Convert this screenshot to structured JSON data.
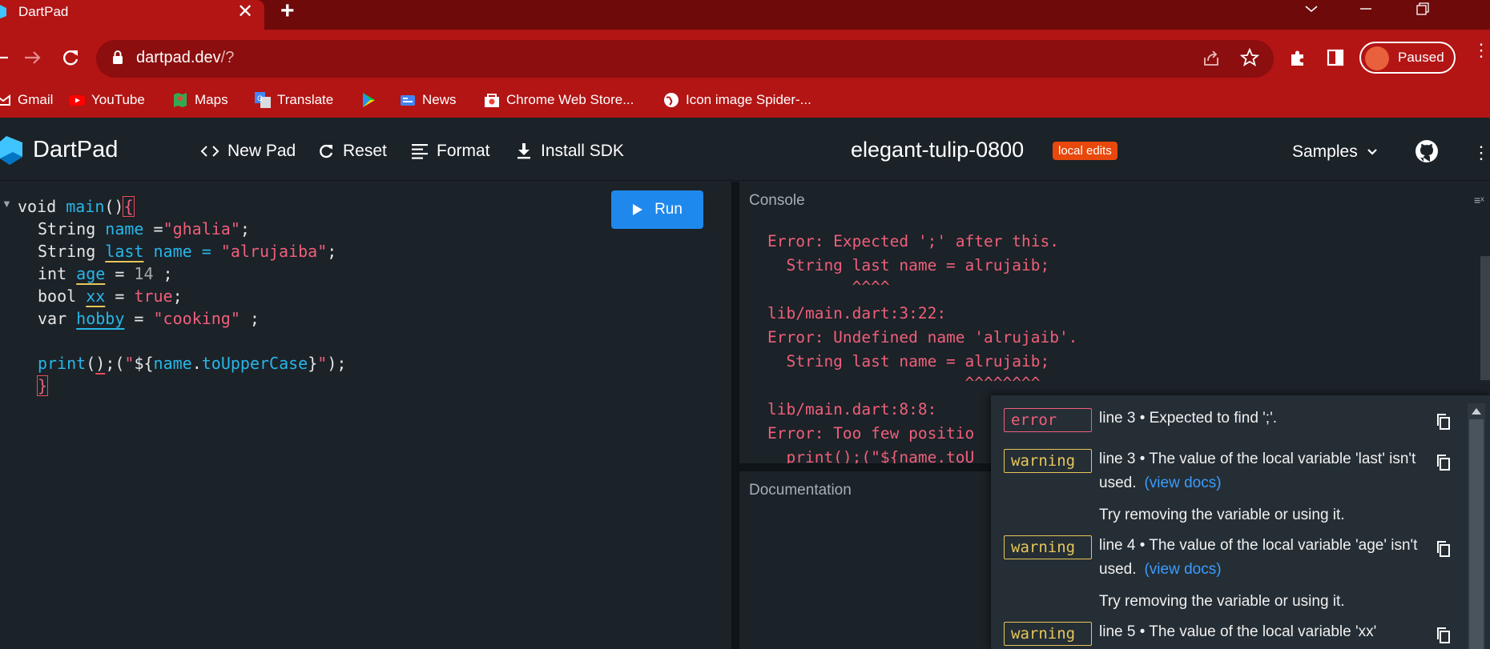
{
  "browser": {
    "tab": {
      "title": "DartPad",
      "close": "✕"
    },
    "new_tab": "+",
    "url": {
      "host": "dartpad.dev",
      "path": "/?"
    },
    "profile": {
      "status": "Paused"
    },
    "bookmarks": [
      {
        "label": "Gmail",
        "icon": "gmail-icon"
      },
      {
        "label": "YouTube",
        "icon": "youtube-icon"
      },
      {
        "label": "Maps",
        "icon": "maps-icon"
      },
      {
        "label": "Translate",
        "icon": "translate-icon"
      },
      {
        "label": "",
        "icon": "play-store-icon"
      },
      {
        "label": "News",
        "icon": "news-icon"
      },
      {
        "label": "Chrome Web Store...",
        "icon": "web-store-icon"
      },
      {
        "label": "Icon image Spider-...",
        "icon": "globe-icon"
      }
    ]
  },
  "dartpad": {
    "title": "DartPad",
    "actions": {
      "new_pad": "New Pad",
      "reset": "Reset",
      "format": "Format",
      "install_sdk": "Install SDK"
    },
    "pad_name": "elegant-tulip-0800",
    "badge": "local edits",
    "samples": "Samples",
    "run": "Run"
  },
  "editor": {
    "lines": {
      "l1": {
        "kw": "void ",
        "fn": "main",
        "p1": "()",
        "brace": "{"
      },
      "l2": {
        "kw": "String ",
        "var": "name",
        "eq": " =",
        "str": "\"ghalia\"",
        "end": ";"
      },
      "l3": {
        "kw": "String ",
        "var": "last",
        "mid": " name = ",
        "str": "\"alrujaiba\"",
        "end": ";"
      },
      "l4": {
        "kw": "int ",
        "var": "age",
        "eq": " = ",
        "num": "14",
        "end": " ;"
      },
      "l5": {
        "kw": "bool ",
        "var": "xx",
        "eq": " = ",
        "val": "true",
        "end": ";"
      },
      "l6": {
        "kw": "var ",
        "var": "hobby",
        "eq": " = ",
        "str": "\"cooking\"",
        "end": " ;"
      },
      "l8": {
        "fn": "print",
        "p1": "(",
        "p2": ")",
        "semi": ";(",
        "q1": "\"",
        "d": "${",
        "id": "name",
        "dot": ".",
        "prop": "toUpperCase",
        "cl": "}",
        "q2": "\"",
        "end": ");"
      },
      "l9": {
        "brace": "}"
      }
    }
  },
  "console": {
    "label": "Console",
    "lines": [
      "Error: Expected ';' after this.",
      "  String last name = alrujaib;",
      "         ^^^^",
      "lib/main.dart:3:22:",
      "Error: Undefined name 'alrujaib'.",
      "  String last name = alrujaib;",
      "                     ^^^^^^^^",
      "lib/main.dart:8:8:",
      "Error: Too few positio",
      "  print();(\"${name.toU"
    ]
  },
  "documentation": {
    "label": "Documentation"
  },
  "issues": [
    {
      "severity": "error",
      "message": "line 3 • Expected to find ';'.",
      "link": "",
      "hint": ""
    },
    {
      "severity": "warning",
      "message": "line 3 • The value of the local variable 'last' isn't used.",
      "link": "(view docs)",
      "hint": "Try removing the variable or using it."
    },
    {
      "severity": "warning",
      "message": "line 4 • The value of the local variable 'age' isn't used.",
      "link": "(view docs)",
      "hint": "Try removing the variable or using it."
    },
    {
      "severity": "warning",
      "message": "line 5 • The value of the local variable 'xx'",
      "link": "",
      "hint": ""
    }
  ]
}
